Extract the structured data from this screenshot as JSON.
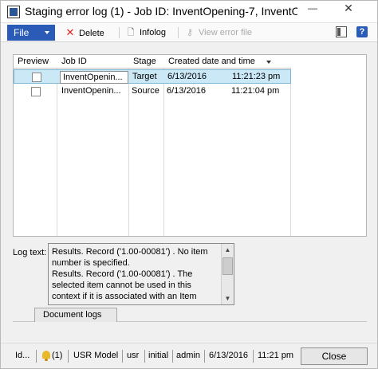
{
  "window": {
    "title": "Staging error log (1) - Job ID: InventOpening-7, InventO...",
    "minimize_glyph": "—",
    "close_glyph": "✕"
  },
  "actionpane": {
    "file_label": "File",
    "delete_label": "Delete",
    "infolog_label": "Infolog",
    "view_error_label": "View error file",
    "help_glyph": "?"
  },
  "grid": {
    "columns": [
      "Preview",
      "Job ID",
      "Stage",
      "Created date and time"
    ],
    "rows": [
      {
        "preview": false,
        "job_id": "InventOpenin...",
        "stage": "Target",
        "date": "6/13/2016",
        "time": "11:21:23 pm",
        "selected": true
      },
      {
        "preview": false,
        "job_id": "InventOpenin...",
        "stage": "Source",
        "date": "6/13/2016",
        "time": "11:21:04 pm",
        "selected": false
      }
    ]
  },
  "log": {
    "label": "Log text:",
    "text": "Results. Record ('1.00-00081') . No item number is specified.\nResults. Record ('1.00-00081') . The selected item cannot be used in this context if it is associated with an Item"
  },
  "tabs": [
    {
      "label": "Document logs"
    }
  ],
  "statusbar": {
    "id": "Id...",
    "notifications": "(1)",
    "model": "USR Model",
    "user": "usr",
    "layer": "initial",
    "company": "admin",
    "date": "6/13/2016",
    "time": "11:21 pm",
    "close_label": "Close"
  },
  "colors": {
    "accent": "#2a5bb6",
    "selection": "#cbe8f6",
    "delete_icon": "#dd2222"
  }
}
